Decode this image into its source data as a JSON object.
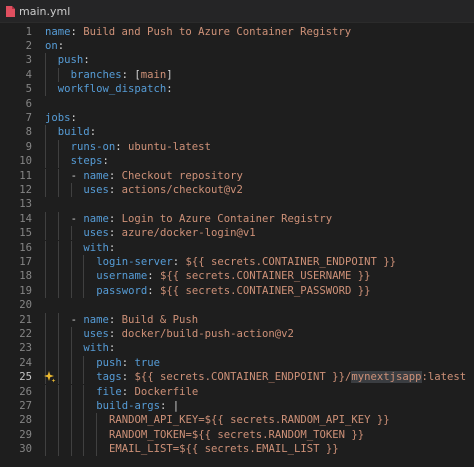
{
  "tab": {
    "filename": "main.yml",
    "icon": "yaml-file-icon",
    "icon_color": "#e04f5f"
  },
  "active_line": 25,
  "colors": {
    "key": "#569cd6",
    "string": "#ce9178",
    "punctuation": "#d4d4d4",
    "background": "#1e1e1e"
  },
  "lines": [
    {
      "n": "1",
      "indent": 0,
      "tokens": [
        [
          "k",
          "name"
        ],
        [
          "p",
          ": "
        ],
        [
          "s",
          "Build and Push to Azure Container Registry"
        ]
      ]
    },
    {
      "n": "2",
      "indent": 0,
      "tokens": [
        [
          "k",
          "on"
        ],
        [
          "p",
          ":"
        ]
      ]
    },
    {
      "n": "3",
      "indent": 2,
      "tokens": [
        [
          "k",
          "push"
        ],
        [
          "p",
          ":"
        ]
      ]
    },
    {
      "n": "4",
      "indent": 4,
      "tokens": [
        [
          "k",
          "branches"
        ],
        [
          "p",
          ": ["
        ],
        [
          "s",
          "main"
        ],
        [
          "p",
          "]"
        ]
      ]
    },
    {
      "n": "5",
      "indent": 2,
      "tokens": [
        [
          "k",
          "workflow_dispatch"
        ],
        [
          "p",
          ":"
        ]
      ]
    },
    {
      "n": "6",
      "indent": 0,
      "tokens": []
    },
    {
      "n": "7",
      "indent": 0,
      "tokens": [
        [
          "k",
          "jobs"
        ],
        [
          "p",
          ":"
        ]
      ]
    },
    {
      "n": "8",
      "indent": 2,
      "tokens": [
        [
          "k",
          "build"
        ],
        [
          "p",
          ":"
        ]
      ]
    },
    {
      "n": "9",
      "indent": 4,
      "tokens": [
        [
          "k",
          "runs-on"
        ],
        [
          "p",
          ": "
        ],
        [
          "s",
          "ubuntu-latest"
        ]
      ]
    },
    {
      "n": "10",
      "indent": 4,
      "tokens": [
        [
          "k",
          "steps"
        ],
        [
          "p",
          ":"
        ]
      ]
    },
    {
      "n": "11",
      "indent": 4,
      "tokens": [
        [
          "p",
          "- "
        ],
        [
          "k",
          "name"
        ],
        [
          "p",
          ": "
        ],
        [
          "s",
          "Checkout repository"
        ]
      ]
    },
    {
      "n": "12",
      "indent": 6,
      "tokens": [
        [
          "k",
          "uses"
        ],
        [
          "p",
          ": "
        ],
        [
          "s",
          "actions/checkout@v2"
        ]
      ]
    },
    {
      "n": "13",
      "indent": 0,
      "tokens": []
    },
    {
      "n": "14",
      "indent": 4,
      "tokens": [
        [
          "p",
          "- "
        ],
        [
          "k",
          "name"
        ],
        [
          "p",
          ": "
        ],
        [
          "s",
          "Login to Azure Container Registry"
        ]
      ]
    },
    {
      "n": "15",
      "indent": 6,
      "tokens": [
        [
          "k",
          "uses"
        ],
        [
          "p",
          ": "
        ],
        [
          "s",
          "azure/docker-login@v1"
        ]
      ]
    },
    {
      "n": "16",
      "indent": 6,
      "tokens": [
        [
          "k",
          "with"
        ],
        [
          "p",
          ":"
        ]
      ]
    },
    {
      "n": "17",
      "indent": 8,
      "tokens": [
        [
          "k",
          "login-server"
        ],
        [
          "p",
          ": "
        ],
        [
          "s",
          "${{ secrets.CONTAINER_ENDPOINT }}"
        ]
      ]
    },
    {
      "n": "18",
      "indent": 8,
      "tokens": [
        [
          "k",
          "username"
        ],
        [
          "p",
          ": "
        ],
        [
          "s",
          "${{ secrets.CONTAINER_USERNAME }}"
        ]
      ]
    },
    {
      "n": "19",
      "indent": 8,
      "tokens": [
        [
          "k",
          "password"
        ],
        [
          "p",
          ": "
        ],
        [
          "s",
          "${{ secrets.CONTAINER_PASSWORD }}"
        ]
      ]
    },
    {
      "n": "20",
      "indent": 0,
      "tokens": []
    },
    {
      "n": "21",
      "indent": 4,
      "tokens": [
        [
          "p",
          "- "
        ],
        [
          "k",
          "name"
        ],
        [
          "p",
          ": "
        ],
        [
          "s",
          "Build & Push"
        ]
      ]
    },
    {
      "n": "22",
      "indent": 6,
      "tokens": [
        [
          "k",
          "uses"
        ],
        [
          "p",
          ": "
        ],
        [
          "s",
          "docker/build-push-action@v2"
        ]
      ]
    },
    {
      "n": "23",
      "indent": 6,
      "tokens": [
        [
          "k",
          "with"
        ],
        [
          "p",
          ":"
        ]
      ]
    },
    {
      "n": "24",
      "indent": 8,
      "tokens": [
        [
          "k",
          "push"
        ],
        [
          "p",
          ": "
        ],
        [
          "k",
          "true"
        ]
      ]
    },
    {
      "n": "25",
      "indent": 8,
      "tokens": [
        [
          "k",
          "tags"
        ],
        [
          "p",
          ": "
        ],
        [
          "s",
          "${{ secrets.CONTAINER_ENDPOINT }}/"
        ],
        [
          "sel",
          "mynextjsapp"
        ],
        [
          "s",
          ":latest"
        ]
      ]
    },
    {
      "n": "26",
      "indent": 8,
      "tokens": [
        [
          "k",
          "file"
        ],
        [
          "p",
          ": "
        ],
        [
          "s",
          "Dockerfile"
        ]
      ]
    },
    {
      "n": "27",
      "indent": 8,
      "tokens": [
        [
          "k",
          "build-args"
        ],
        [
          "p",
          ": |"
        ]
      ]
    },
    {
      "n": "28",
      "indent": 10,
      "tokens": [
        [
          "s",
          "RANDOM_API_KEY=${{ secrets.RANDOM_API_KEY }}"
        ]
      ]
    },
    {
      "n": "29",
      "indent": 10,
      "tokens": [
        [
          "s",
          "RANDOM_TOKEN=${{ secrets.RANDOM_TOKEN }}"
        ]
      ]
    },
    {
      "n": "30",
      "indent": 10,
      "tokens": [
        [
          "s",
          "EMAIL_LIST=${{ secrets.EMAIL_LIST }}"
        ]
      ]
    }
  ]
}
